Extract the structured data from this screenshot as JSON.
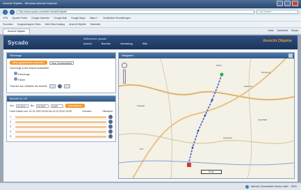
{
  "window": {
    "title": "Ansicht Objekte - Windows Internet Explorer"
  },
  "browser": {
    "address": "http://www.sycado.com/web/?ansichtObjekte",
    "search_placeholder": "Live Search",
    "links": [
      "VPN",
      "Sycado Portal",
      "Google Kalender",
      "Google Mail",
      "Google Maps",
      "https://...",
      "Zusätzliche Einstellungen"
    ],
    "favorites": [
      "Favoriten",
      "Vorgeschlagene Sites",
      "Web Slice-Katalog",
      "Ansicht Objekte",
      "Startseite",
      "Seite",
      "Sicherheit",
      "Extras"
    ],
    "tab_label": "Ansicht Objekte",
    "commands": [
      "Seite",
      "Sicherheit",
      "Extras"
    ]
  },
  "site": {
    "logo": "Sycado",
    "welcome": "Willkommen, jansala",
    "nav": [
      "Ansicht",
      "Berichte",
      "Verwaltung",
      "Hilfe"
    ],
    "brand_text": "Ansicht Objekte"
  },
  "left_panel": {
    "title": "Fahrzeuge",
    "search_button": "Neue gespeicherte Ansichten",
    "select_value": "Neue Gesamtansicht",
    "filter_label": "Fahrzeuge in der Ansicht auswählen",
    "tree": [
      "Fahrzeuge",
      "Fahrer"
    ],
    "summary": "Total der aus Gebieten der Ansicht"
  },
  "report_panel": {
    "title": "Berichte Nr. 1/5",
    "from_label": "Von",
    "from_date": "01.2010",
    "to_label": "Bis",
    "to_date": "01.2010",
    "time": "10:00",
    "button": "Aktualisieren",
    "header": "Fahrt Datum von: 01.01.2010 00:00 bis 31.01.2010 23:59",
    "links": [
      "Drucken",
      "Übersicht"
    ],
    "rows": [
      "1",
      "2",
      "3",
      "4",
      "5"
    ]
  },
  "map": {
    "title": "Navigation",
    "scale": "5 km",
    "labels": [
      "Worth",
      "Stuttgart",
      "Ulm",
      "Heilbronn",
      "Augsburg",
      "Ingolstadt",
      "Nürnberg"
    ],
    "route_color": "#5a6cc8"
  },
  "status": {
    "zone": "Internet | Geschützter Modus: Aktiv",
    "zoom": "100%"
  },
  "colors": {
    "accent": "#f39a2f",
    "header": "#2f4f7f"
  }
}
